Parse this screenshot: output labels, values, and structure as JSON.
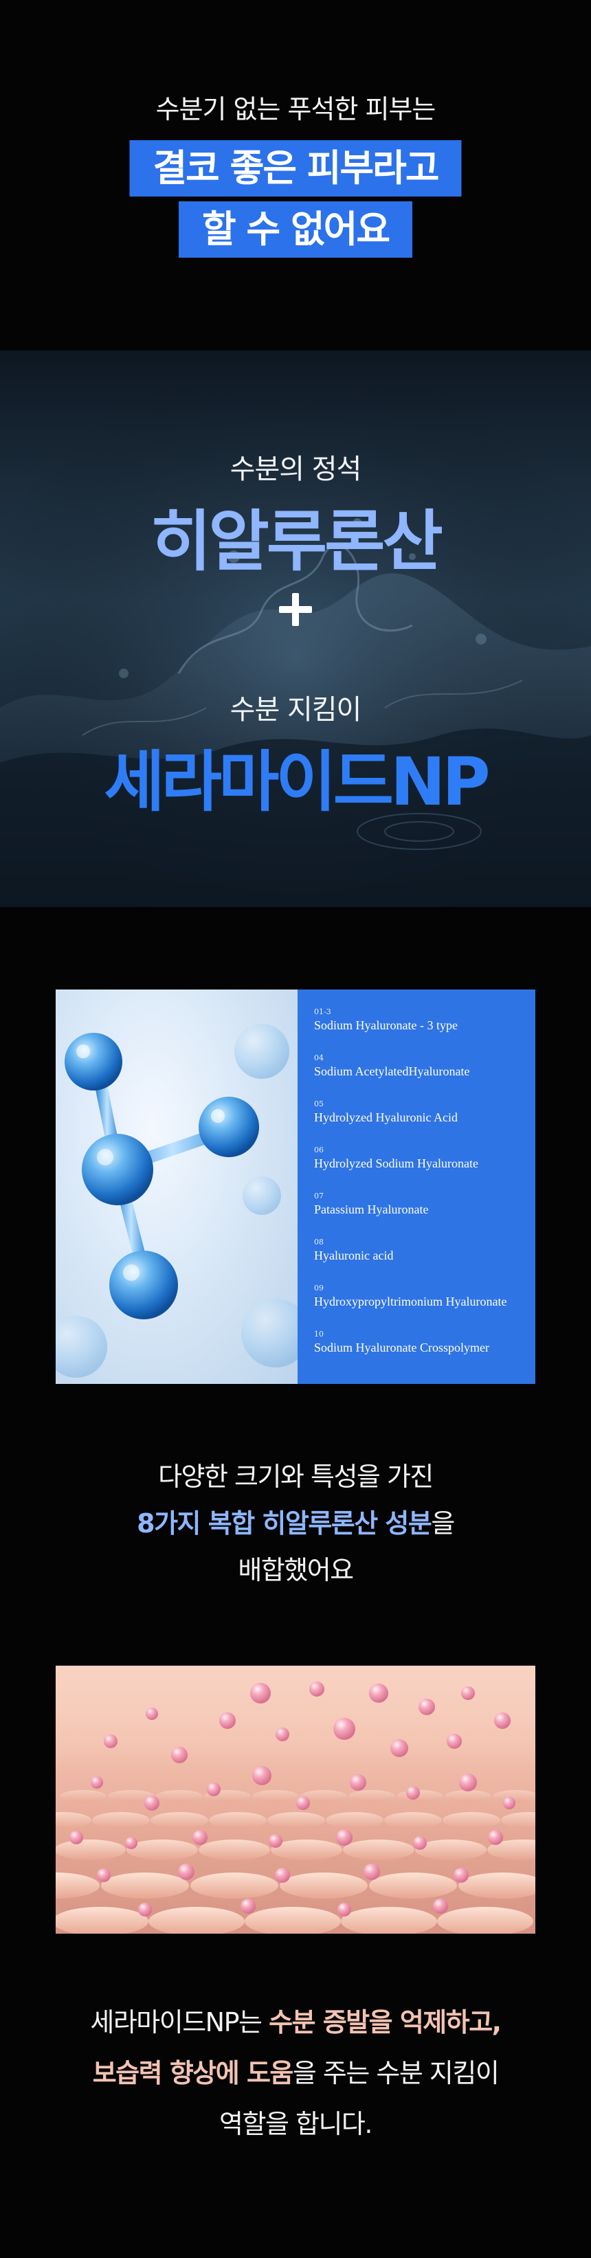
{
  "intro": {
    "subtitle": "수분기 없는 푸석한 피부는",
    "headline_line1": "결코 좋은 피부라고",
    "headline_line2": "할 수 없어요",
    "highlight_color": "#2c72ea"
  },
  "water_section": {
    "label1": "수분의 정석",
    "ingredient1": "히알루론산",
    "plus_icon": "plus-icon",
    "label2": "수분 지킴이",
    "ingredient2": "세라마이드NP",
    "ingredient1_color": "#8fb6ff",
    "ingredient2_color": "#2f7df6"
  },
  "ingredients_card": {
    "image_icon": "molecule-image",
    "panel_color": "#2f74e4",
    "items": [
      {
        "num": "01-3",
        "name": "Sodium Hyaluronate - 3 type"
      },
      {
        "num": "04",
        "name": "Sodium AcetylatedHyaluronate"
      },
      {
        "num": "05",
        "name": "Hydrolyzed Hyaluronic Acid"
      },
      {
        "num": "06",
        "name": "Hydrolyzed Sodium Hyaluronate"
      },
      {
        "num": "07",
        "name": "Patassium Hyaluronate"
      },
      {
        "num": "08",
        "name": "Hyaluronic acid"
      },
      {
        "num": "09",
        "name": "Hydroxypropyltrimonium Hyaluronate"
      },
      {
        "num": "10",
        "name": "Sodium Hyaluronate Crosspolymer"
      }
    ]
  },
  "hyaluronic_desc": {
    "line1": "다양한 크기와 특성을 가진",
    "line2_accent": "8가지 복합 히알루론산 성분",
    "line2_rest": "을",
    "line3": "배합했어요"
  },
  "skin_image": {
    "icon": "skin-barrier-image"
  },
  "ceramide_desc": {
    "line1_plain": "세라마이드NP는 ",
    "line1_accent": "수분 증발을 억제하고,",
    "line2_accent": "보습력 향상에 도움",
    "line2_rest": "을 주는 수분 지킴이",
    "line3": "역할을 합니다.",
    "accent_color": "#f4c3b2"
  }
}
